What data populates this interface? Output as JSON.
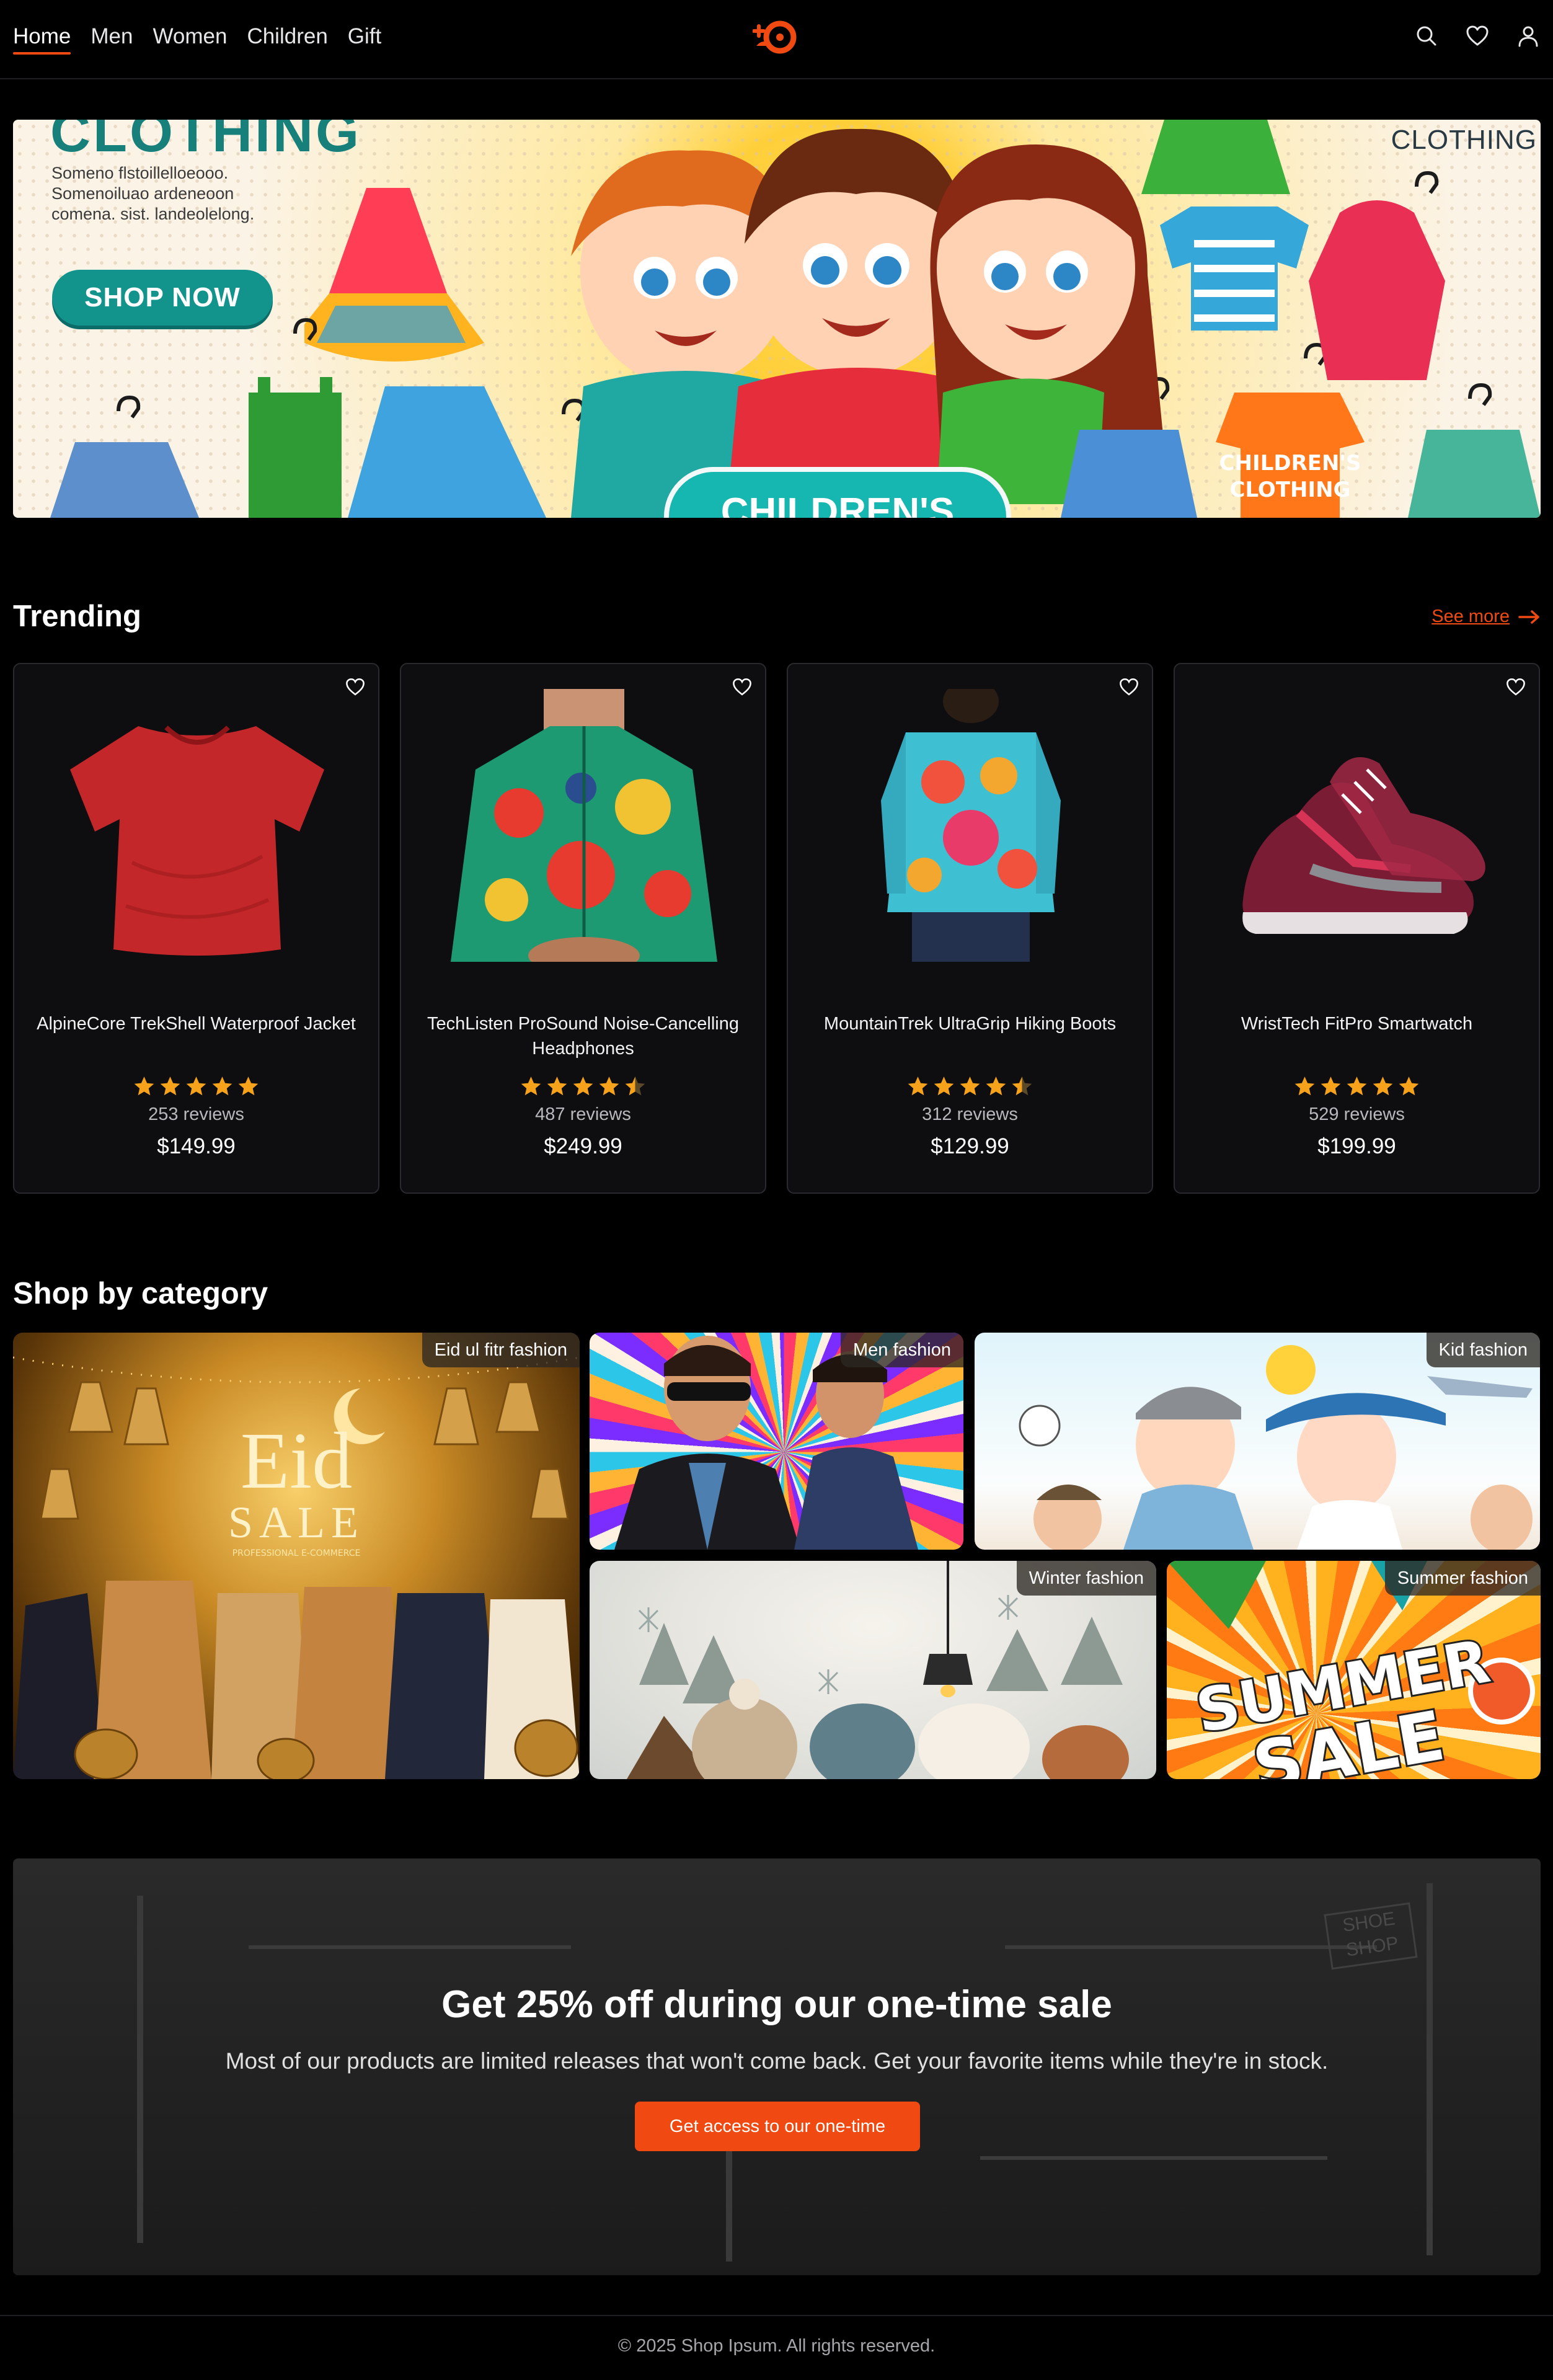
{
  "nav": {
    "items": [
      "Home",
      "Men",
      "Women",
      "Children",
      "Gift"
    ],
    "active": "Home"
  },
  "header": {
    "icons": [
      "search-icon",
      "heart-icon",
      "user-icon"
    ],
    "accent": "#f04a12"
  },
  "hero": {
    "title_top": "CLOTHING",
    "right_tag": "CLOTHING",
    "lines": [
      "Someno flstoillelloeooo.",
      "Somenoiluao ardeneoon",
      "comena. sist. landeolelong."
    ],
    "cta": "SHOP NOW",
    "bottom_banner": "CHILDREN'S",
    "shirt_text": "CHILDREN'S CLOTHING"
  },
  "trending": {
    "title": "Trending",
    "see_more": "See more",
    "products": [
      {
        "name": "AlpineCore TrekShell Waterproof Jacket",
        "rating": 5,
        "reviews": "253 reviews",
        "price": "$149.99"
      },
      {
        "name": "TechListen ProSound Noise-Cancelling Headphones",
        "rating": 4.5,
        "reviews": "487 reviews",
        "price": "$249.99"
      },
      {
        "name": "MountainTrek UltraGrip Hiking Boots",
        "rating": 4.5,
        "reviews": "312 reviews",
        "price": "$129.99"
      },
      {
        "name": "WristTech FitPro Smartwatch",
        "rating": 5,
        "reviews": "529 reviews",
        "price": "$199.99"
      }
    ]
  },
  "categories": {
    "title": "Shop by category",
    "eid": {
      "tag": "Eid ul fitr fashion",
      "headline": "Eid",
      "sub": "SALE",
      "small": "PROFESSIONAL E-COMMERCE"
    },
    "men": {
      "tag": "Men fashion"
    },
    "kids": {
      "tag": "Kid fashion"
    },
    "winter": {
      "tag": "Winter fashion"
    },
    "summer": {
      "tag": "Summer fashion",
      "headline": "SUMMER",
      "sub": "SALE"
    }
  },
  "sale": {
    "title": "Get 25% off during our one-time sale",
    "body": "Most of our products are limited releases that won't come back. Get your favorite items while they're in stock.",
    "cta": "Get access to our one-time",
    "store_sign": "SHOE SHOP"
  },
  "footer": {
    "copyright": "© 2025 Shop Ipsum. All rights reserved."
  }
}
